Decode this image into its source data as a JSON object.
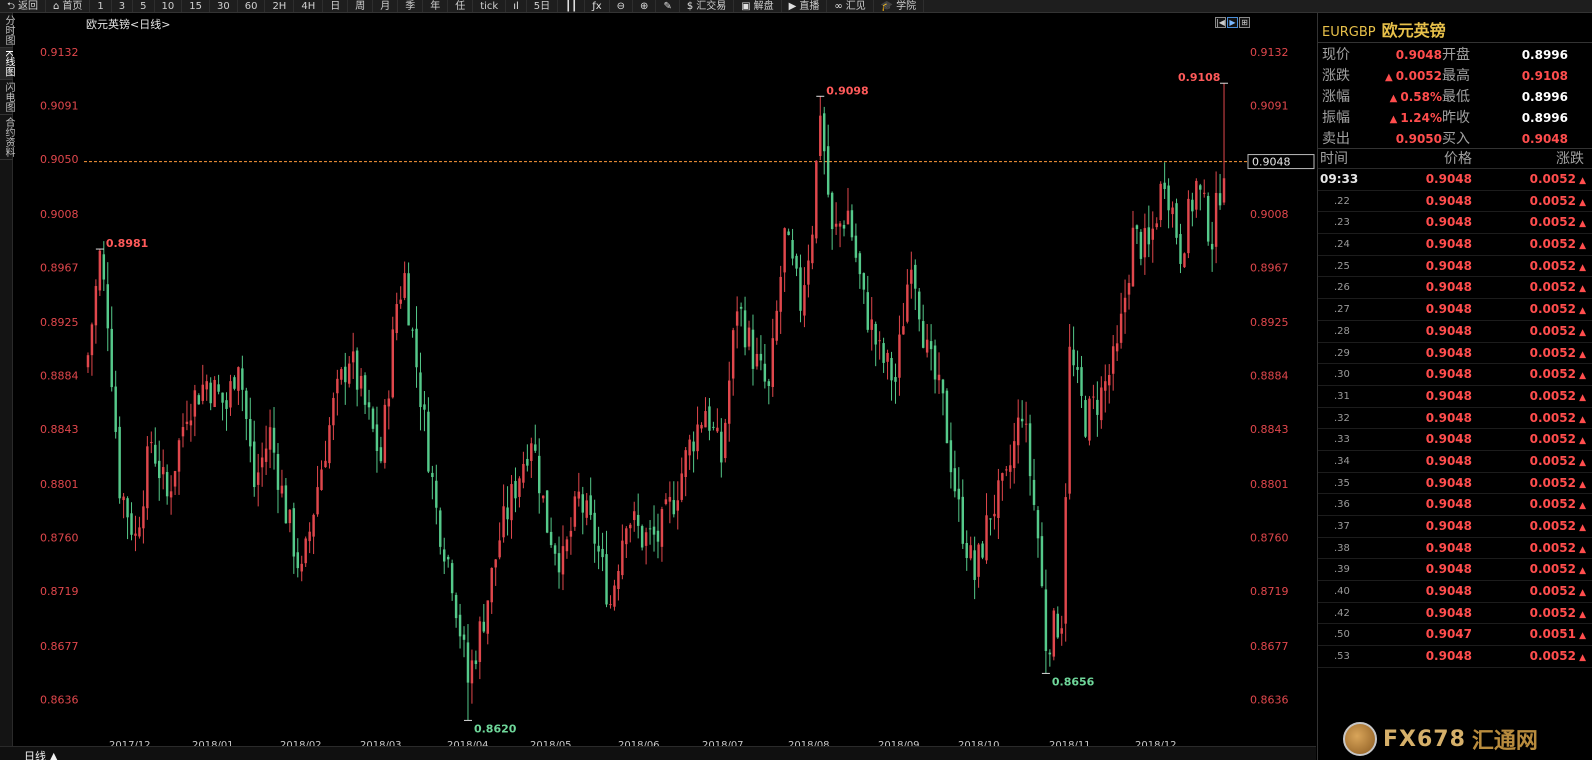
{
  "toolbar": {
    "items": [
      {
        "icon": "back-arrow-icon",
        "glyph": "⮌",
        "label": "返回"
      },
      {
        "icon": "home-icon",
        "glyph": "⌂",
        "label": "首页"
      },
      {
        "label": "1"
      },
      {
        "label": "3"
      },
      {
        "label": "5"
      },
      {
        "label": "10"
      },
      {
        "label": "15"
      },
      {
        "label": "30"
      },
      {
        "label": "60"
      },
      {
        "label": "2H"
      },
      {
        "label": "4H"
      },
      {
        "label": "日"
      },
      {
        "label": "周"
      },
      {
        "label": "月"
      },
      {
        "label": "季"
      },
      {
        "label": "年"
      },
      {
        "label": "任"
      },
      {
        "label": "tick"
      },
      {
        "icon": "bar-chart-icon",
        "glyph": "ıl"
      },
      {
        "label": "5日"
      },
      {
        "icon": "candles-icon",
        "glyph": "┃┃"
      },
      {
        "icon": "function-icon",
        "glyph": "ƒx"
      },
      {
        "icon": "zoom-out-icon",
        "glyph": "⊖"
      },
      {
        "icon": "zoom-in-icon",
        "glyph": "⊕"
      },
      {
        "icon": "draw-pen-icon",
        "glyph": "✎"
      },
      {
        "icon": "dollar-icon",
        "glyph": "$",
        "label": "汇交易"
      },
      {
        "icon": "chat-icon",
        "glyph": "▣",
        "label": "解盘"
      },
      {
        "icon": "play-icon",
        "glyph": "▶",
        "label": "直播"
      },
      {
        "icon": "link-icon",
        "glyph": "∞",
        "label": "汇见"
      },
      {
        "icon": "graduation-cap-icon",
        "glyph": "🎓",
        "label": "学院"
      }
    ]
  },
  "sidetabs": [
    "分时图",
    "K线图",
    "闪电图",
    "合约资料"
  ],
  "chart": {
    "title": "欧元英镑<日线>",
    "period_label": "日线 ▲",
    "current_price_label": "0.9048",
    "ctrl_buttons": [
      "|◀",
      "▶",
      "⊞"
    ]
  },
  "chart_data": {
    "type": "candlestick",
    "title": "欧元英镑<日线>",
    "y_ticks": [
      "0.9132",
      "0.9091",
      "0.9050",
      "0.9008",
      "0.8967",
      "0.8925",
      "0.8884",
      "0.8843",
      "0.8801",
      "0.8760",
      "0.8719",
      "0.8677",
      "0.8636"
    ],
    "x_ticks": [
      "2017/12",
      "2018/01",
      "2018/02",
      "2018/03",
      "2018/04",
      "2018/05",
      "2018/06",
      "2018/07",
      "2018/08",
      "2018/09",
      "2018/10",
      "2018/11",
      "2018/12"
    ],
    "ylim": [
      0.8605,
      0.9148
    ],
    "current_price": 0.9048,
    "annotations": [
      {
        "label": "0.8981",
        "type": "high",
        "idx": 3
      },
      {
        "label": "0.8620",
        "type": "low",
        "idx": 96
      },
      {
        "label": "0.9098",
        "type": "high",
        "idx": 185
      },
      {
        "label": "0.8656",
        "type": "low",
        "idx": 242
      },
      {
        "label": "0.9108",
        "type": "high",
        "idx": 287
      }
    ],
    "close_path": [
      [
        0,
        0.89
      ],
      [
        3,
        0.8975
      ],
      [
        5,
        0.893
      ],
      [
        8,
        0.88
      ],
      [
        12,
        0.876
      ],
      [
        16,
        0.8835
      ],
      [
        20,
        0.879
      ],
      [
        25,
        0.886
      ],
      [
        30,
        0.888
      ],
      [
        35,
        0.886
      ],
      [
        38,
        0.89
      ],
      [
        42,
        0.88
      ],
      [
        46,
        0.884
      ],
      [
        50,
        0.878
      ],
      [
        54,
        0.873
      ],
      [
        58,
        0.88
      ],
      [
        62,
        0.886
      ],
      [
        66,
        0.89
      ],
      [
        70,
        0.886
      ],
      [
        74,
        0.882
      ],
      [
        78,
        0.894
      ],
      [
        80,
        0.896
      ],
      [
        84,
        0.887
      ],
      [
        88,
        0.878
      ],
      [
        92,
        0.873
      ],
      [
        96,
        0.865
      ],
      [
        100,
        0.87
      ],
      [
        104,
        0.876
      ],
      [
        108,
        0.88
      ],
      [
        112,
        0.884
      ],
      [
        116,
        0.877
      ],
      [
        120,
        0.874
      ],
      [
        124,
        0.879
      ],
      [
        128,
        0.876
      ],
      [
        132,
        0.871
      ],
      [
        136,
        0.878
      ],
      [
        140,
        0.876
      ],
      [
        144,
        0.876
      ],
      [
        148,
        0.879
      ],
      [
        152,
        0.883
      ],
      [
        156,
        0.886
      ],
      [
        160,
        0.882
      ],
      [
        164,
        0.894
      ],
      [
        168,
        0.89
      ],
      [
        172,
        0.887
      ],
      [
        176,
        0.899
      ],
      [
        180,
        0.894
      ],
      [
        183,
        0.9
      ],
      [
        185,
        0.909
      ],
      [
        188,
        0.899
      ],
      [
        192,
        0.901
      ],
      [
        196,
        0.894
      ],
      [
        200,
        0.89
      ],
      [
        204,
        0.888
      ],
      [
        208,
        0.898
      ],
      [
        212,
        0.89
      ],
      [
        216,
        0.886
      ],
      [
        220,
        0.878
      ],
      [
        224,
        0.873
      ],
      [
        228,
        0.878
      ],
      [
        232,
        0.88
      ],
      [
        236,
        0.886
      ],
      [
        240,
        0.876
      ],
      [
        242,
        0.868
      ],
      [
        246,
        0.87
      ],
      [
        248,
        0.89
      ],
      [
        252,
        0.885
      ],
      [
        256,
        0.887
      ],
      [
        260,
        0.89
      ],
      [
        264,
        0.899
      ],
      [
        268,
        0.898
      ],
      [
        272,
        0.904
      ],
      [
        276,
        0.898
      ],
      [
        280,
        0.903
      ],
      [
        284,
        0.899
      ],
      [
        287,
        0.9048
      ]
    ],
    "n_candles": 288
  },
  "quote": {
    "symbol": "EURGBP",
    "name": "欧元英镑",
    "rows": [
      [
        {
          "label": "现价",
          "value": "0.9048",
          "color": "red"
        },
        {
          "label": "开盘",
          "value": "0.8996",
          "color": "white"
        }
      ],
      [
        {
          "label": "涨跌",
          "value": "0.0052",
          "arrow": true,
          "color": "red"
        },
        {
          "label": "最高",
          "value": "0.9108",
          "color": "red"
        }
      ],
      [
        {
          "label": "涨幅",
          "value": "0.58%",
          "arrow": true,
          "color": "red"
        },
        {
          "label": "最低",
          "value": "0.8996",
          "color": "white"
        }
      ],
      [
        {
          "label": "振幅",
          "value": "1.24%",
          "arrow": true,
          "color": "red"
        },
        {
          "label": "昨收",
          "value": "0.8996",
          "color": "white"
        }
      ],
      [
        {
          "label": "卖出",
          "value": "0.9050",
          "color": "red"
        },
        {
          "label": "买入",
          "value": "0.9048",
          "color": "red"
        }
      ]
    ],
    "ticks_header": {
      "time": "时间",
      "price": "价格",
      "change": "涨跌"
    },
    "ticks": [
      {
        "time": "09:33",
        "price": "0.9048",
        "change": "0.0052"
      },
      {
        "time": ".22",
        "price": "0.9048",
        "change": "0.0052"
      },
      {
        "time": ".23",
        "price": "0.9048",
        "change": "0.0052"
      },
      {
        "time": ".24",
        "price": "0.9048",
        "change": "0.0052"
      },
      {
        "time": ".25",
        "price": "0.9048",
        "change": "0.0052"
      },
      {
        "time": ".26",
        "price": "0.9048",
        "change": "0.0052"
      },
      {
        "time": ".27",
        "price": "0.9048",
        "change": "0.0052"
      },
      {
        "time": ".28",
        "price": "0.9048",
        "change": "0.0052"
      },
      {
        "time": ".29",
        "price": "0.9048",
        "change": "0.0052"
      },
      {
        "time": ".30",
        "price": "0.9048",
        "change": "0.0052"
      },
      {
        "time": ".31",
        "price": "0.9048",
        "change": "0.0052"
      },
      {
        "time": ".32",
        "price": "0.9048",
        "change": "0.0052"
      },
      {
        "time": ".33",
        "price": "0.9048",
        "change": "0.0052"
      },
      {
        "time": ".34",
        "price": "0.9048",
        "change": "0.0052"
      },
      {
        "time": ".35",
        "price": "0.9048",
        "change": "0.0052"
      },
      {
        "time": ".36",
        "price": "0.9048",
        "change": "0.0052"
      },
      {
        "time": ".37",
        "price": "0.9048",
        "change": "0.0052"
      },
      {
        "time": ".38",
        "price": "0.9048",
        "change": "0.0052"
      },
      {
        "time": ".39",
        "price": "0.9048",
        "change": "0.0052"
      },
      {
        "time": ".40",
        "price": "0.9048",
        "change": "0.0052"
      },
      {
        "time": ".42",
        "price": "0.9048",
        "change": "0.0052"
      },
      {
        "time": ".50",
        "price": "0.9047",
        "change": "0.0051"
      },
      {
        "time": ".53",
        "price": "0.9048",
        "change": "0.0052"
      }
    ]
  },
  "watermark": {
    "brand": "FX678",
    "cn": "汇通网"
  },
  "colors": {
    "up": "#e0474c",
    "down": "#55c98a",
    "axis_text": "#e0474c",
    "grid_line": "#ff9a3c",
    "accent": "#e8c14a"
  }
}
